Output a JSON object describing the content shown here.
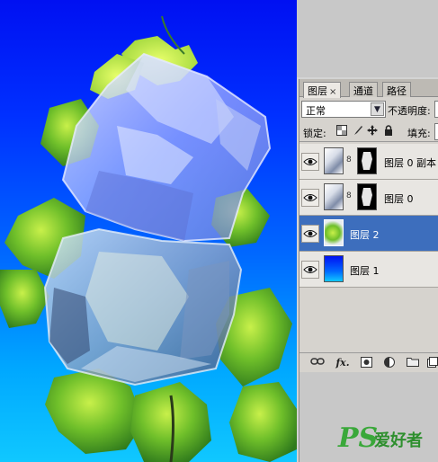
{
  "tabs": [
    {
      "label": "图层",
      "close": "×",
      "active": true
    },
    {
      "label": "通道",
      "active": false
    },
    {
      "label": "路径",
      "active": false
    }
  ],
  "blend_mode": {
    "value": "正常"
  },
  "opacity": {
    "label": "不透明度:"
  },
  "lock": {
    "label": "锁定:"
  },
  "fill": {
    "label": "填充:"
  },
  "layers": [
    {
      "name": "图层 0 副本",
      "visible": true,
      "has_mask": true,
      "selected": false
    },
    {
      "name": "图层 0",
      "visible": true,
      "has_mask": true,
      "selected": false
    },
    {
      "name": "图层 2",
      "visible": true,
      "has_mask": false,
      "selected": true
    },
    {
      "name": "图层 1",
      "visible": true,
      "has_mask": false,
      "selected": false
    }
  ],
  "bottom_icons": [
    "link-icon",
    "fx-icon",
    "add-mask-icon",
    "adjustment-icon",
    "new-group-icon",
    "new-layer-icon"
  ],
  "bottom_labels": {
    "fx": "fx."
  },
  "watermark": {
    "ps": "PS",
    "cn": "爱好者"
  },
  "colors": {
    "canvas_top": "#0010f2",
    "canvas_bottom": "#10c8ff",
    "selected_layer": "#3d6ebd",
    "panel_bg": "#d6d3ce",
    "watermark": "#3aa83a"
  }
}
